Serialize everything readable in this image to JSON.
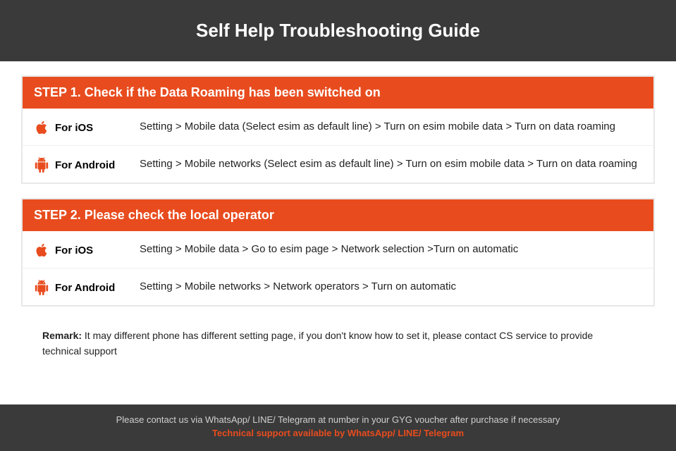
{
  "header": {
    "title": "Self Help Troubleshooting Guide"
  },
  "step1": {
    "header": "STEP 1.  Check if the Data Roaming has been switched on",
    "ios": {
      "label": "For iOS",
      "text": "Setting > Mobile data (Select esim as default line) > Turn on esim mobile data > Turn on data roaming"
    },
    "android": {
      "label": "For Android",
      "text": "Setting > Mobile networks (Select esim as default line) > Turn on esim mobile data > Turn on data roaming"
    }
  },
  "step2": {
    "header": "STEP 2.  Please check the local operator",
    "ios": {
      "label": "For iOS",
      "text": "Setting > Mobile data > Go to esim page > Network selection >Turn on automatic"
    },
    "android": {
      "label": "For Android",
      "text": "Setting > Mobile networks > Network operators > Turn on automatic"
    }
  },
  "remark": {
    "bold": "Remark:",
    "text": " It may different phone has different setting page, if you don't know how to set it,  please contact CS service to provide technical support"
  },
  "footer": {
    "contact": "Please contact us via WhatsApp/ LINE/ Telegram at number in your GYG voucher after purchase if necessary",
    "support": "Technical support available by WhatsApp/ LINE/ Telegram"
  }
}
